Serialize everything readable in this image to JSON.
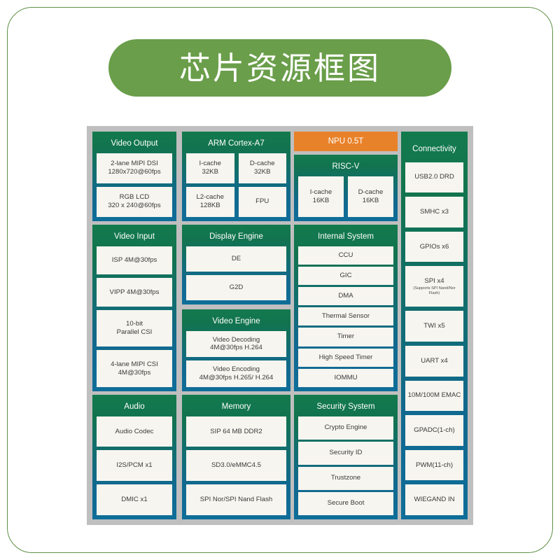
{
  "title": "芯片资源框图",
  "colors": {
    "frame_border": "#5f9144",
    "title_pill": "#6a9e4a",
    "canvas": "#bfbfbf",
    "block_gradient_top": "#137a4d",
    "block_gradient_bottom": "#0f6e99",
    "npu_orange": "#e8822a",
    "item_bg": "#f7f5ef"
  },
  "blocks": {
    "video_output": {
      "title": "Video Output",
      "items": [
        {
          "l1": "2-lane MIPI DSI",
          "l2": "1280x720@60fps"
        },
        {
          "l1": "RGB LCD",
          "l2": "320 x 240@60fps"
        }
      ]
    },
    "arm": {
      "title": "ARM Cortex-A7",
      "items": [
        {
          "l1": "I-cache",
          "l2": "32KB"
        },
        {
          "l1": "D-cache",
          "l2": "32KB"
        },
        {
          "l1": "L2-cache",
          "l2": "128KB"
        },
        {
          "l1": "FPU",
          "l2": ""
        }
      ]
    },
    "npu": {
      "title": "NPU 0.5T"
    },
    "riscv": {
      "title": "RISC-V",
      "items": [
        {
          "l1": "I-cache",
          "l2": "16KB"
        },
        {
          "l1": "D-cache",
          "l2": "16KB"
        }
      ]
    },
    "connectivity": {
      "title": "Connectivity",
      "items": [
        {
          "l1": "USB2.0 DRD",
          "l2": ""
        },
        {
          "l1": "SMHC x3",
          "l2": ""
        },
        {
          "l1": "GPIOs x6",
          "l2": ""
        },
        {
          "l1": "SPI x4",
          "sub": "(Supports SPI Nand/Nor Flash)"
        },
        {
          "l1": "TWI x5",
          "l2": ""
        },
        {
          "l1": "UART x4",
          "l2": ""
        },
        {
          "l1": "10M/100M EMAC",
          "l2": ""
        },
        {
          "l1": "GPADC(1-ch)",
          "l2": ""
        },
        {
          "l1": "PWM(11-ch)",
          "l2": ""
        },
        {
          "l1": "WIEGAND IN",
          "l2": ""
        }
      ]
    },
    "video_input": {
      "title": "Video Input",
      "items": [
        {
          "l1": "ISP 4M@30fps",
          "l2": ""
        },
        {
          "l1": "VIPP 4M@30fps",
          "l2": ""
        },
        {
          "l1": "10-bit",
          "l2": "Parallel CSI"
        },
        {
          "l1": "4-lane MIPI CSI",
          "l2": "4M@30fps"
        }
      ]
    },
    "display_engine": {
      "title": "Display Engine",
      "items": [
        {
          "l1": "DE",
          "l2": ""
        },
        {
          "l1": "G2D",
          "l2": ""
        }
      ]
    },
    "video_engine": {
      "title": "Video Engine",
      "items": [
        {
          "l1": "Video Decoding",
          "l2": "4M@30fps H.264"
        },
        {
          "l1": "Video Encoding",
          "l2": "4M@30fps H.265/ H.264"
        }
      ]
    },
    "internal_system": {
      "title": "Internal System",
      "items": [
        {
          "l1": "CCU",
          "l2": ""
        },
        {
          "l1": "GIC",
          "l2": ""
        },
        {
          "l1": "DMA",
          "l2": ""
        },
        {
          "l1": "Thermal Sensor",
          "l2": ""
        },
        {
          "l1": "Timer",
          "l2": ""
        },
        {
          "l1": "High Speed Timer",
          "l2": ""
        },
        {
          "l1": "IOMMU",
          "l2": ""
        }
      ]
    },
    "audio": {
      "title": "Audio",
      "items": [
        {
          "l1": "Audio Codec",
          "l2": ""
        },
        {
          "l1": "I2S/PCM x1",
          "l2": ""
        },
        {
          "l1": "DMIC x1",
          "l2": ""
        }
      ]
    },
    "memory": {
      "title": "Memory",
      "items": [
        {
          "l1": "SIP 64 MB DDR2",
          "l2": ""
        },
        {
          "l1": "SD3.0/eMMC4.5",
          "l2": ""
        },
        {
          "l1": "SPI Nor/SPI Nand Flash",
          "l2": ""
        }
      ]
    },
    "security_system": {
      "title": "Security System",
      "items": [
        {
          "l1": "Crypto Engine",
          "l2": ""
        },
        {
          "l1": "Security ID",
          "l2": ""
        },
        {
          "l1": "Trustzone",
          "l2": ""
        },
        {
          "l1": "Secure Boot",
          "l2": ""
        }
      ]
    }
  }
}
